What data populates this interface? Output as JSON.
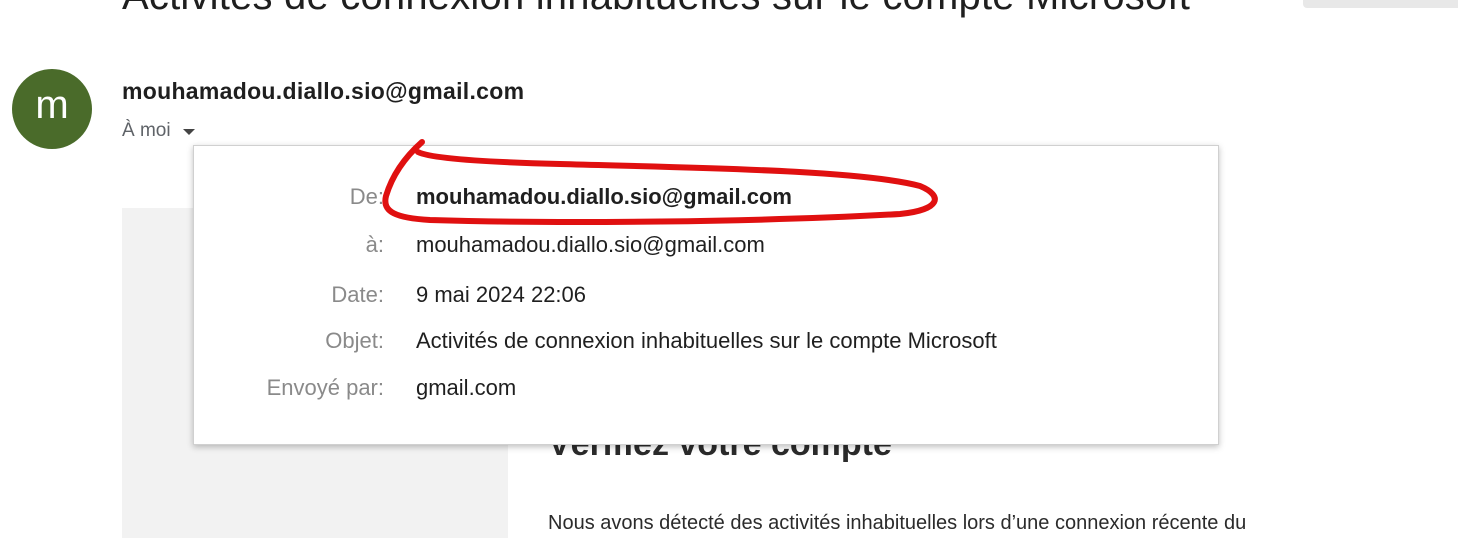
{
  "email": {
    "subject": "Activités de connexion inhabituelles sur le compte Microsoft",
    "avatar_letter": "m",
    "sender": "mouhamadou.diallo.sio@gmail.com",
    "recipient_summary": "À moi"
  },
  "details_popup": {
    "rows": [
      {
        "label": "De:",
        "value": "mouhamadou.diallo.sio@gmail.com"
      },
      {
        "label": "à:",
        "value": "mouhamadou.diallo.sio@gmail.com"
      },
      {
        "label": "Date:",
        "value": "9 mai 2024 22:06"
      },
      {
        "label": "Objet:",
        "value": "Activités de connexion inhabituelles sur le compte Microsoft"
      },
      {
        "label": "Envoyé par:",
        "value": "gmail.com"
      }
    ]
  },
  "body": {
    "heading": "Vérifiez votre compte",
    "paragraph": "Nous avons détecté des activités inhabituelles lors d’une connexion récente du"
  },
  "colors": {
    "avatar": "#4a6b2a",
    "annotation": "#e01010"
  }
}
